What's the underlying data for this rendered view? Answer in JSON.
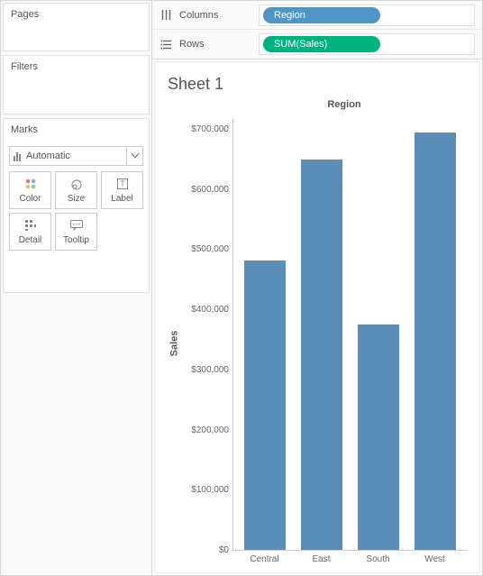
{
  "left": {
    "pages_label": "Pages",
    "filters_label": "Filters",
    "marks_label": "Marks",
    "marks_type": "Automatic",
    "mark_buttons": {
      "color": "Color",
      "size": "Size",
      "label": "Label",
      "detail": "Detail",
      "tooltip": "Tooltip"
    }
  },
  "shelves": {
    "columns_label": "Columns",
    "rows_label": "Rows",
    "columns_pill": "Region",
    "rows_pill": "SUM(Sales)"
  },
  "viz": {
    "sheet_title": "Sheet 1",
    "column_header": "Region",
    "y_axis_label": "Sales",
    "y_ticks": [
      "$700,000",
      "$600,000",
      "$500,000",
      "$400,000",
      "$300,000",
      "$200,000",
      "$100,000",
      "$0"
    ],
    "x_ticks": [
      "Central",
      "East",
      "South",
      "West"
    ]
  },
  "chart_data": {
    "type": "bar",
    "title": "Sheet 1",
    "column_field": "Region",
    "xlabel": "",
    "ylabel": "Sales",
    "ylim": [
      0,
      750000
    ],
    "y_format": "$,.0f",
    "categories": [
      "Central",
      "East",
      "South",
      "West"
    ],
    "values": [
      503000,
      680000,
      392000,
      726000
    ],
    "series": [
      {
        "name": "SUM(Sales)",
        "values": [
          503000,
          680000,
          392000,
          726000
        ]
      }
    ],
    "bar_color": "#5b8fb9"
  }
}
